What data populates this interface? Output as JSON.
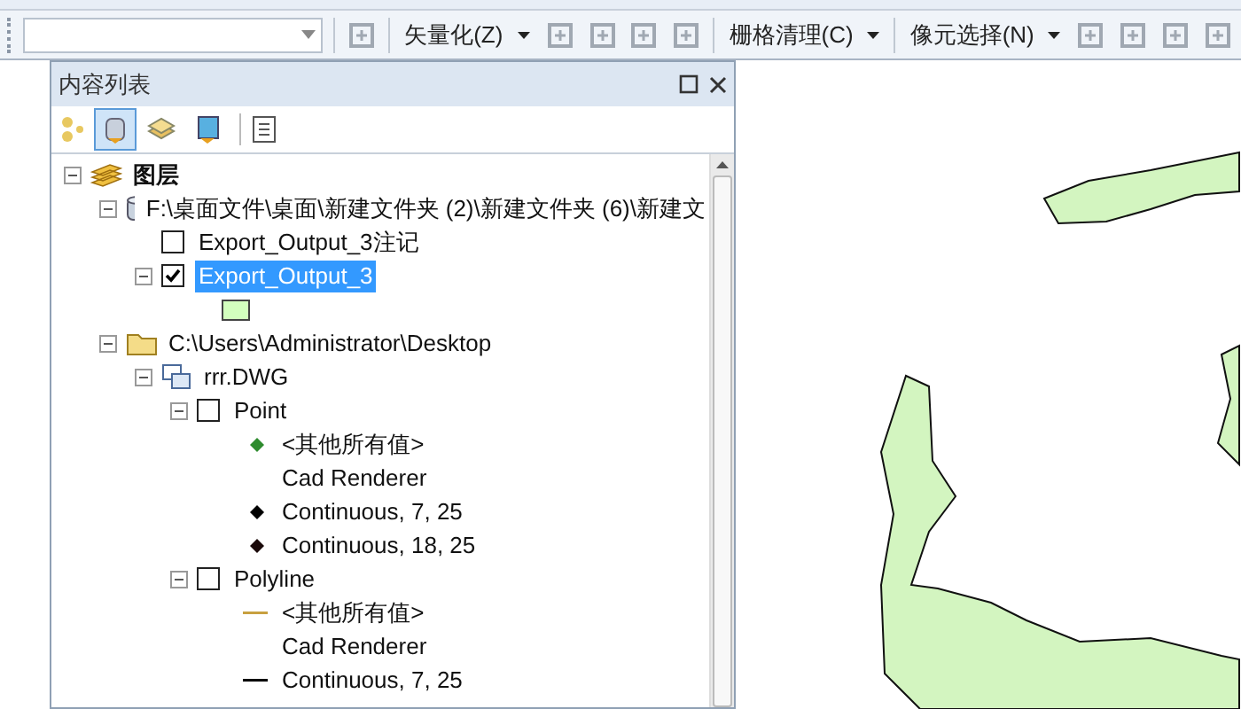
{
  "toolbar": {
    "items": [
      {
        "kind": "combo"
      },
      {
        "kind": "icon"
      },
      {
        "kind": "menu",
        "label": "矢量化(Z)"
      },
      {
        "kind": "icon"
      },
      {
        "kind": "icon"
      },
      {
        "kind": "icon"
      },
      {
        "kind": "icon"
      },
      {
        "kind": "menu",
        "label": "栅格清理(C)"
      },
      {
        "kind": "menu",
        "label": "像元选择(N)"
      },
      {
        "kind": "icon"
      },
      {
        "kind": "icon"
      },
      {
        "kind": "icon"
      },
      {
        "kind": "icon"
      }
    ]
  },
  "toc": {
    "title": "内容列表",
    "tabs": [
      {
        "kind": "source",
        "selected": true
      },
      {
        "kind": "display",
        "selected": false
      },
      {
        "kind": "selection",
        "selected": false
      }
    ],
    "tree": [
      {
        "kind": "group",
        "label": "图层",
        "expanded": true,
        "selected": false,
        "children": [
          {
            "kind": "database",
            "label": "F:\\桌面文件\\桌面\\新建文件夹 (2)\\新建文件夹 (6)\\新建文",
            "expanded": true,
            "selected": false,
            "children": [
              {
                "kind": "layer",
                "label": "Export_Output_3注记",
                "checked": false,
                "selected": false
              },
              {
                "kind": "layer",
                "label": "Export_Output_3",
                "checked": true,
                "expanded": true,
                "selected": true,
                "children": [
                  {
                    "kind": "patch",
                    "color": "#d3ffbe"
                  }
                ]
              }
            ]
          },
          {
            "kind": "folder",
            "label": "C:\\Users\\Administrator\\Desktop",
            "expanded": true,
            "selected": false,
            "children": [
              {
                "kind": "cad",
                "label": "rrr.DWG",
                "expanded": true,
                "selected": false,
                "children": [
                  {
                    "kind": "layer",
                    "label": "Point",
                    "checked": false,
                    "expanded": true,
                    "selected": false,
                    "children": [
                      {
                        "kind": "point",
                        "label": "<其他所有值>",
                        "color": "#2e8b2e",
                        "selected": false
                      },
                      {
                        "kind": "heading",
                        "label": "Cad Renderer"
                      },
                      {
                        "kind": "point",
                        "label": "Continuous, 7, 25",
                        "color": "#000000",
                        "selected": false
                      },
                      {
                        "kind": "point",
                        "label": "Continuous, 18, 25",
                        "color": "#1a0a0a",
                        "selected": false
                      }
                    ]
                  },
                  {
                    "kind": "layer",
                    "label": "Polyline",
                    "checked": false,
                    "expanded": true,
                    "selected": false,
                    "children": [
                      {
                        "kind": "line",
                        "label": "<其他所有值>",
                        "color": "#c8a040",
                        "selected": false
                      },
                      {
                        "kind": "heading",
                        "label": "Cad Renderer"
                      },
                      {
                        "kind": "line",
                        "label": "Continuous, 7, 25",
                        "color": "#000000",
                        "selected": false
                      }
                    ]
                  }
                ]
              }
            ]
          }
        ]
      }
    ]
  }
}
